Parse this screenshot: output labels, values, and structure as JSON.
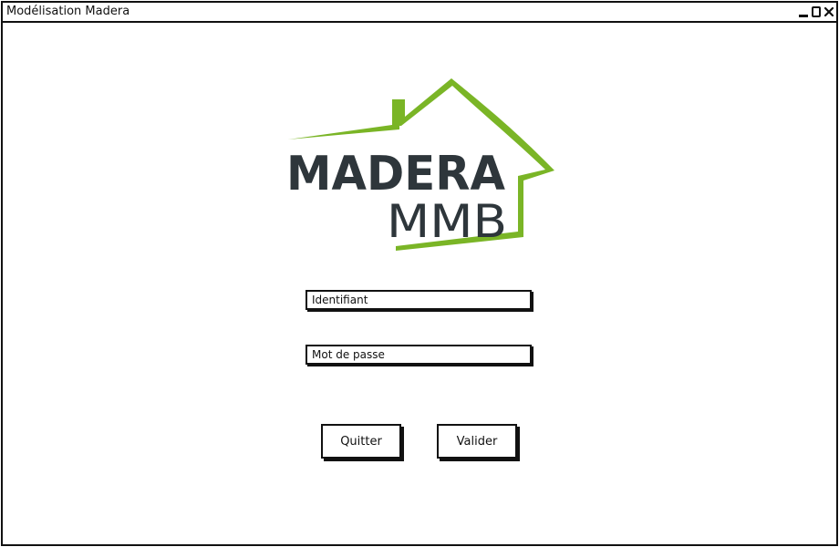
{
  "window": {
    "title": "Modélisation Madera",
    "controls": {
      "minimize_icon": "minimize-icon",
      "maximize_icon": "maximize-icon",
      "close_icon": "close-icon"
    }
  },
  "logo": {
    "brand_line1": "MADERA",
    "brand_line2": "MMB",
    "colors": {
      "roof": "#7ab526",
      "text": "#2e363b"
    }
  },
  "login": {
    "identifiant_placeholder": "Identifiant",
    "password_placeholder": "Mot de passe"
  },
  "actions": {
    "quit_label": "Quitter",
    "submit_label": "Valider"
  }
}
